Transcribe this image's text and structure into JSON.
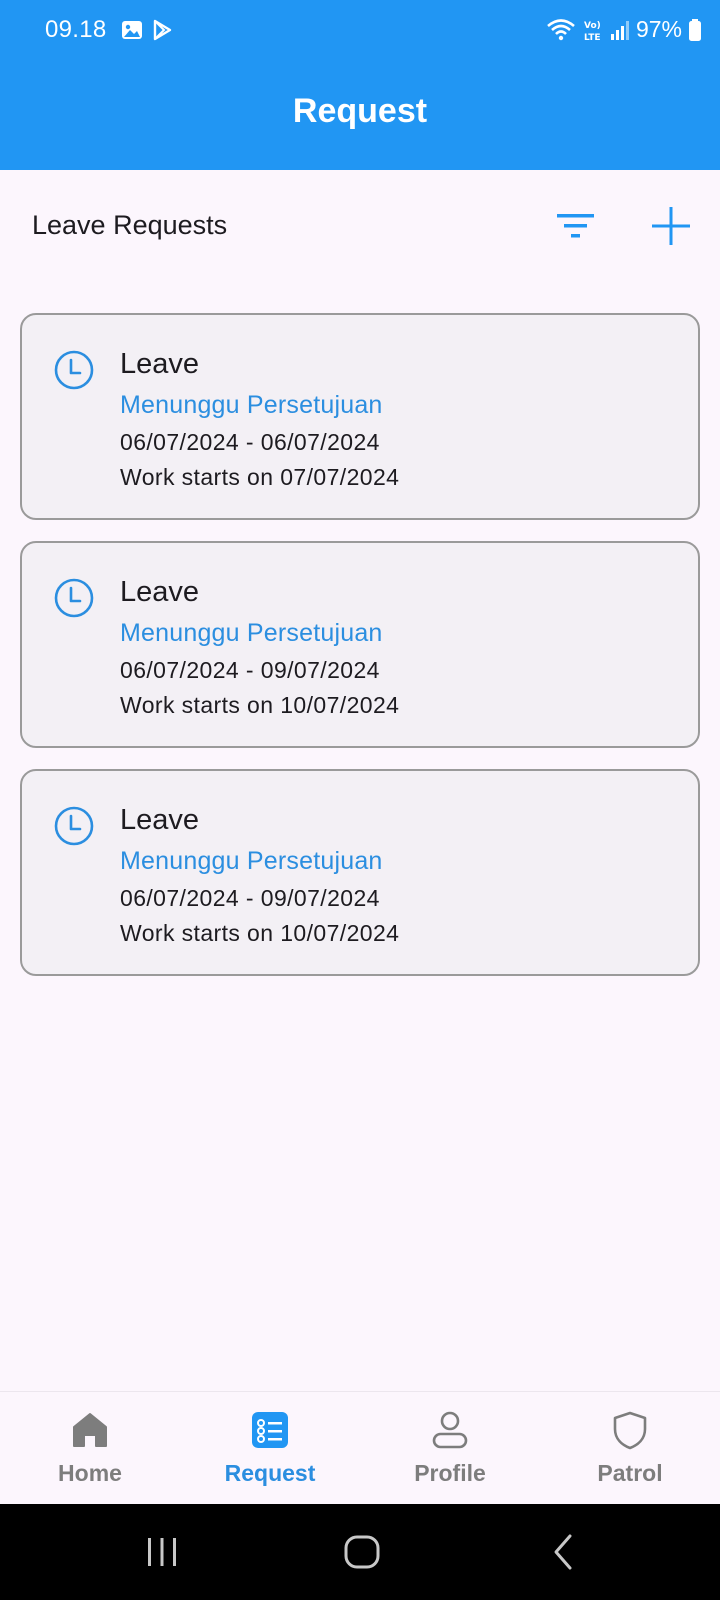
{
  "status_bar": {
    "time": "09.18",
    "battery": "97%",
    "icons": [
      "image-icon",
      "play-store-icon",
      "wifi-icon",
      "volte-icon",
      "signal-icon",
      "battery-icon"
    ]
  },
  "app_bar": {
    "title": "Request"
  },
  "header": {
    "title": "Leave Requests",
    "filter_icon": "filter-icon",
    "add_icon": "plus-icon"
  },
  "requests": [
    {
      "type": "Leave",
      "status": "Menunggu Persetujuan",
      "dates": "06/07/2024 - 06/07/2024",
      "work_starts": "Work starts on 07/07/2024",
      "icon": "clock-icon"
    },
    {
      "type": "Leave",
      "status": "Menunggu Persetujuan",
      "dates": "06/07/2024 - 09/07/2024",
      "work_starts": "Work starts on 10/07/2024",
      "icon": "clock-icon"
    },
    {
      "type": "Leave",
      "status": "Menunggu Persetujuan",
      "dates": "06/07/2024 - 09/07/2024",
      "work_starts": "Work starts on 10/07/2024",
      "icon": "clock-icon"
    }
  ],
  "bottom_nav": {
    "items": [
      {
        "label": "Home",
        "icon": "home-icon",
        "active": false
      },
      {
        "label": "Request",
        "icon": "request-list-icon",
        "active": true
      },
      {
        "label": "Profile",
        "icon": "person-icon",
        "active": false
      },
      {
        "label": "Patrol",
        "icon": "shield-icon",
        "active": false
      }
    ]
  },
  "system_nav": {
    "buttons": [
      "recent-apps-icon",
      "home-circle-icon",
      "back-chevron-icon"
    ]
  },
  "colors": {
    "primary": "#2196f3",
    "accent_text": "#2b8ee0",
    "background": "#fcf6fd",
    "card": "#f3f0f5",
    "inactive": "#7d7d7d"
  }
}
